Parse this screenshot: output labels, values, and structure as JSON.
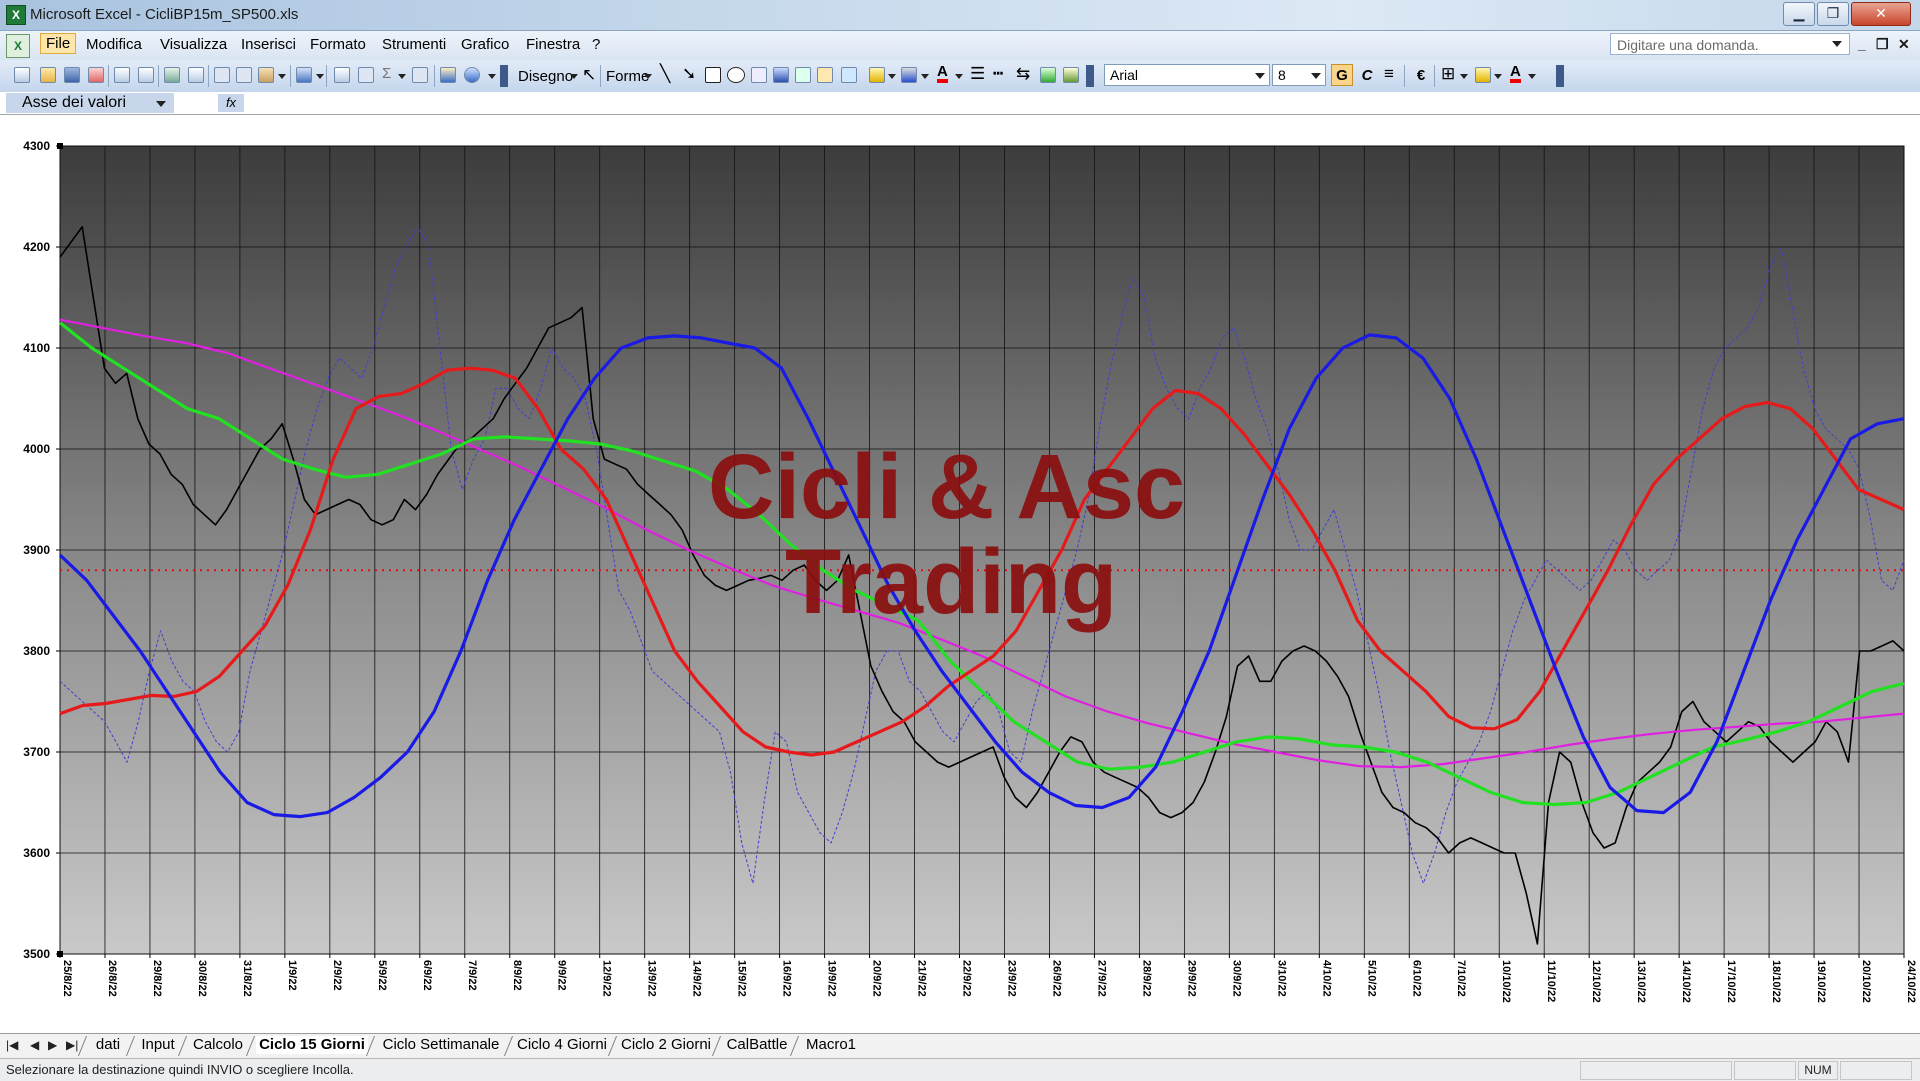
{
  "window": {
    "app_title": "Microsoft Excel - CicliBP15m_SP500.xls"
  },
  "menu": {
    "items": [
      "File",
      "Modifica",
      "Visualizza",
      "Inserisci",
      "Formato",
      "Strumenti",
      "Grafico",
      "Finestra",
      "?"
    ],
    "help_placeholder": "Digitare una domanda."
  },
  "toolbar": {
    "drawing_label": "Disegno",
    "shapes_label": "Forme",
    "font_name": "Arial",
    "font_size": "8",
    "bold_label": "G",
    "italic_label": "C",
    "euro_label": "€"
  },
  "formula_bar": {
    "name_box": "Asse dei valori",
    "fx_label": "fx"
  },
  "chart_data": {
    "type": "line",
    "watermark": [
      "Cicli & Asc",
      "Trading"
    ],
    "ylim": [
      3500,
      4300
    ],
    "yticks": [
      "3500",
      "3600",
      "3700",
      "3800",
      "3900",
      "4000",
      "4100",
      "4200",
      "4300"
    ],
    "xticks": [
      "25/8/22",
      "26/8/22",
      "29/8/22",
      "30/8/22",
      "31/8/22",
      "1/9/22",
      "2/9/22",
      "5/9/22",
      "6/9/22",
      "7/9/22",
      "8/9/22",
      "9/9/22",
      "12/9/22",
      "13/9/22",
      "14/9/22",
      "15/9/22",
      "16/9/22",
      "19/9/22",
      "20/9/22",
      "21/9/22",
      "22/9/22",
      "23/9/22",
      "26/9/22",
      "27/9/22",
      "28/9/22",
      "29/9/22",
      "30/9/22",
      "3/10/22",
      "4/10/22",
      "5/10/22",
      "6/10/22",
      "7/10/22",
      "10/10/22",
      "11/10/22",
      "12/10/22",
      "13/10/22",
      "14/10/22",
      "17/10/22",
      "18/10/22",
      "19/10/22",
      "20/10/22",
      "24/10/22"
    ],
    "grid": true,
    "reference_line": {
      "value": 3880,
      "color": "#e01010",
      "style": "dotted"
    },
    "series": [
      {
        "color": "#000000",
        "style": "price",
        "values": [
          4190,
          4205,
          4220,
          4150,
          4080,
          4065,
          4075,
          4030,
          4005,
          3995,
          3975,
          3965,
          3945,
          3935,
          3925,
          3940,
          3960,
          3980,
          4000,
          4010,
          4025,
          3990,
          3950,
          3935,
          3940,
          3945,
          3950,
          3945,
          3930,
          3925,
          3930,
          3950,
          3940,
          3955,
          3975,
          3990,
          4005,
          4010,
          4020,
          4030,
          4050,
          4065,
          4080,
          4100,
          4120,
          4125,
          4130,
          4140,
          4030,
          3990,
          3985,
          3980,
          3965,
          3955,
          3945,
          3935,
          3920,
          3895,
          3875,
          3865,
          3860,
          3865,
          3870,
          3872,
          3875,
          3870,
          3880,
          3885,
          3870,
          3860,
          3870,
          3895,
          3840,
          3785,
          3760,
          3740,
          3730,
          3710,
          3700,
          3690,
          3685,
          3690,
          3695,
          3700,
          3705,
          3675,
          3655,
          3645,
          3660,
          3680,
          3700,
          3715,
          3710,
          3690,
          3680,
          3675,
          3670,
          3665,
          3655,
          3640,
          3635,
          3640,
          3650,
          3670,
          3700,
          3735,
          3785,
          3795,
          3770,
          3770,
          3790,
          3800,
          3805,
          3800,
          3790,
          3775,
          3755,
          3720,
          3690,
          3660,
          3645,
          3640,
          3630,
          3625,
          3615,
          3600,
          3610,
          3615,
          3610,
          3605,
          3600,
          3600,
          3560,
          3510,
          3650,
          3700,
          3690,
          3650,
          3620,
          3605,
          3610,
          3645,
          3670,
          3680,
          3690,
          3705,
          3740,
          3750,
          3730,
          3720,
          3710,
          3720,
          3730,
          3725,
          3710,
          3700,
          3690,
          3700,
          3710,
          3730,
          3720,
          3690,
          3800,
          3800,
          3805,
          3810,
          3800
        ]
      },
      {
        "color": "#4040d0",
        "style": "dashed-oscillator",
        "values": [
          3770,
          3760,
          3750,
          3740,
          3730,
          3710,
          3690,
          3730,
          3780,
          3820,
          3790,
          3770,
          3760,
          3730,
          3710,
          3700,
          3720,
          3780,
          3820,
          3860,
          3900,
          3950,
          4000,
          4040,
          4070,
          4090,
          4080,
          4070,
          4100,
          4140,
          4180,
          4200,
          4220,
          4200,
          4100,
          4000,
          3960,
          3990,
          4010,
          4060,
          4060,
          4040,
          4030,
          4060,
          4100,
          4080,
          4070,
          4050,
          4000,
          3930,
          3860,
          3840,
          3810,
          3780,
          3770,
          3760,
          3750,
          3740,
          3730,
          3720,
          3680,
          3610,
          3570,
          3650,
          3720,
          3710,
          3660,
          3640,
          3620,
          3610,
          3640,
          3680,
          3730,
          3780,
          3800,
          3800,
          3770,
          3760,
          3740,
          3720,
          3710,
          3730,
          3750,
          3760,
          3740,
          3700,
          3690,
          3740,
          3780,
          3820,
          3860,
          3900,
          3950,
          4020,
          4080,
          4130,
          4170,
          4150,
          4090,
          4060,
          4040,
          4030,
          4060,
          4080,
          4110,
          4120,
          4090,
          4050,
          4020,
          3980,
          3930,
          3900,
          3900,
          3920,
          3940,
          3900,
          3860,
          3810,
          3760,
          3700,
          3650,
          3600,
          3570,
          3600,
          3640,
          3670,
          3690,
          3710,
          3740,
          3780,
          3820,
          3850,
          3870,
          3890,
          3880,
          3870,
          3860,
          3870,
          3890,
          3910,
          3900,
          3880,
          3870,
          3880,
          3890,
          3920,
          3980,
          4040,
          4080,
          4100,
          4110,
          4120,
          4140,
          4180,
          4200,
          4140,
          4080,
          4040,
          4020,
          4010,
          4000,
          3980,
          3930,
          3870,
          3860,
          3890
        ]
      },
      {
        "color": "#1a1ae6",
        "style": "bold",
        "values": [
          3895,
          3870,
          3835,
          3800,
          3760,
          3720,
          3680,
          3650,
          3638,
          3636,
          3640,
          3655,
          3675,
          3700,
          3740,
          3800,
          3870,
          3930,
          3980,
          4030,
          4070,
          4100,
          4110,
          4112,
          4110,
          4105,
          4100,
          4080,
          4030,
          3975,
          3920,
          3865,
          3820,
          3780,
          3745,
          3710,
          3680,
          3660,
          3647,
          3645,
          3655,
          3685,
          3740,
          3800,
          3875,
          3950,
          4020,
          4070,
          4100,
          4113,
          4110,
          4090,
          4050,
          3990,
          3920,
          3850,
          3780,
          3715,
          3665,
          3642,
          3640,
          3660,
          3710,
          3780,
          3850,
          3910,
          3960,
          4010,
          4025,
          4030
        ]
      },
      {
        "color": "#e61a1a",
        "style": "bold",
        "values": [
          3738,
          3746,
          3748,
          3752,
          3756,
          3755,
          3760,
          3775,
          3800,
          3825,
          3865,
          3920,
          3990,
          4040,
          4052,
          4055,
          4065,
          4078,
          4080,
          4078,
          4070,
          4040,
          4000,
          3980,
          3950,
          3900,
          3850,
          3800,
          3770,
          3745,
          3720,
          3705,
          3700,
          3697,
          3700,
          3710,
          3720,
          3730,
          3745,
          3765,
          3780,
          3795,
          3820,
          3860,
          3900,
          3950,
          3980,
          4010,
          4040,
          4058,
          4055,
          4040,
          4015,
          3985,
          3955,
          3920,
          3880,
          3830,
          3800,
          3780,
          3760,
          3735,
          3724,
          3723,
          3732,
          3760,
          3800,
          3840,
          3880,
          3925,
          3965,
          3990,
          4010,
          4030,
          4042,
          4046,
          4040,
          4020,
          3990,
          3960,
          3950,
          3940
        ]
      },
      {
        "color": "#22e022",
        "style": "bold",
        "values": [
          4125,
          4100,
          4080,
          4060,
          4040,
          4030,
          4010,
          3990,
          3980,
          3972,
          3975,
          3985,
          3995,
          4010,
          4012,
          4010,
          4008,
          4005,
          3998,
          3988,
          3978,
          3960,
          3935,
          3905,
          3880,
          3860,
          3845,
          3830,
          3790,
          3760,
          3730,
          3710,
          3690,
          3683,
          3685,
          3690,
          3700,
          3710,
          3715,
          3713,
          3707,
          3705,
          3700,
          3690,
          3675,
          3660,
          3650,
          3648,
          3650,
          3660,
          3675,
          3690,
          3705,
          3712,
          3720,
          3730,
          3745,
          3760,
          3768
        ]
      },
      {
        "color": "#e020e0",
        "style": "normal",
        "values": [
          4128,
          4120,
          4112,
          4105,
          4095,
          4080,
          4065,
          4050,
          4035,
          4018,
          4000,
          3982,
          3962,
          3942,
          3920,
          3900,
          3882,
          3865,
          3852,
          3840,
          3828,
          3812,
          3795,
          3775,
          3755,
          3740,
          3728,
          3718,
          3708,
          3700,
          3692,
          3686,
          3685,
          3688,
          3694,
          3700,
          3707,
          3713,
          3718,
          3722,
          3725,
          3728,
          3730,
          3734,
          3738
        ]
      }
    ]
  },
  "sheets": {
    "tabs": [
      "dati",
      "Input",
      "Calcolo",
      "Ciclo 15 Giorni",
      "Ciclo Settimanale",
      "Ciclo 4 Giorni",
      "Ciclo 2 Giorni",
      "CalBattle",
      "Macro1"
    ],
    "active_index": 3
  },
  "status": {
    "message": "Selezionare la destinazione quindi INVIO o scegliere Incolla.",
    "num": "NUM"
  }
}
